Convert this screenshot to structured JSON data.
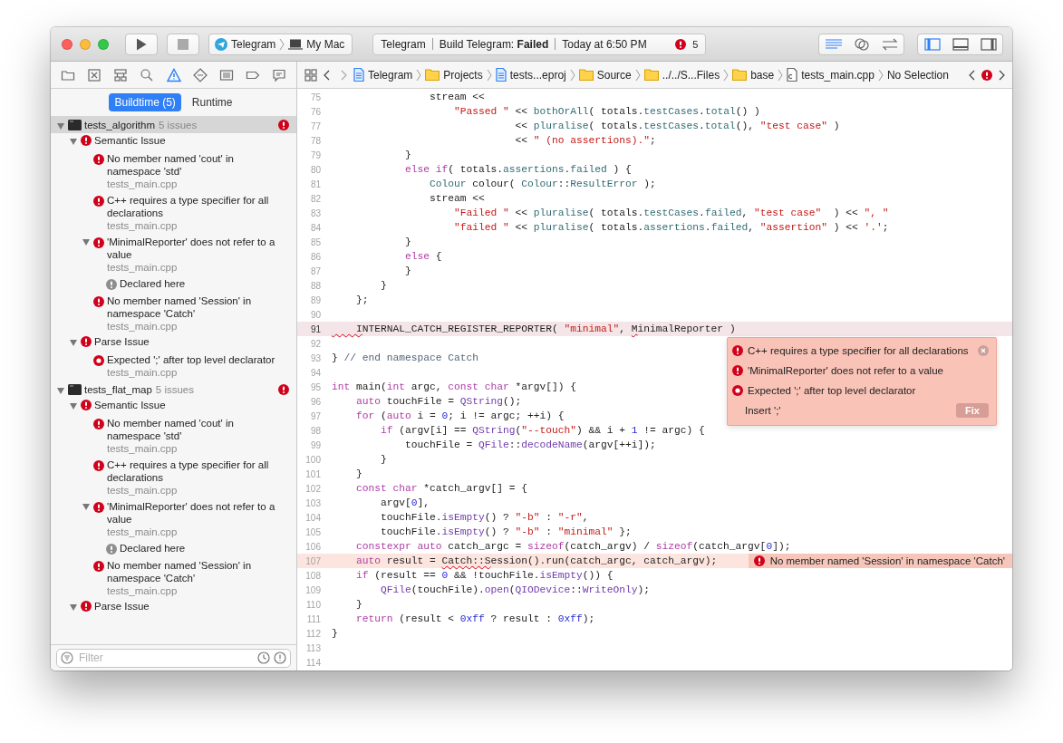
{
  "toolbar": {
    "scheme": {
      "target": "Telegram",
      "destination": "My Mac"
    },
    "activity": {
      "project": "Telegram",
      "status": "Build Telegram: **Failed**",
      "time": "Today at 6:50 PM",
      "error_count": "5"
    },
    "editor_modes": [
      {
        "selected": true
      },
      {
        "selected": false
      },
      {
        "selected": false
      }
    ],
    "panel_toggles": [
      {
        "selected": true
      },
      {
        "selected": false
      },
      {
        "selected": false
      }
    ]
  },
  "navigator_tabs": [
    {
      "selected": false
    },
    {
      "selected": false
    },
    {
      "selected": false
    },
    {
      "selected": false
    },
    {
      "selected": true
    },
    {
      "selected": false
    },
    {
      "selected": false
    },
    {
      "selected": false
    },
    {
      "selected": false
    }
  ],
  "jump_bar": {
    "crumbs": [
      {
        "kind": "project",
        "label": "Telegram"
      },
      {
        "kind": "folder",
        "label": "Projects"
      },
      {
        "kind": "project",
        "label": "tests...eproj"
      },
      {
        "kind": "folder",
        "label": "Source"
      },
      {
        "kind": "folder",
        "label": "../../S...Files"
      },
      {
        "kind": "folder",
        "label": "base"
      },
      {
        "kind": "cpp",
        "label": "tests_main.cpp"
      },
      {
        "kind": "none",
        "label": "No Selection"
      }
    ]
  },
  "sidebar": {
    "tabs": [
      {
        "label": "Buildtime (5)",
        "selected": true
      },
      {
        "label": "Runtime",
        "selected": false
      }
    ],
    "tree": [
      {
        "kind": "target",
        "name": "tests_algorithm",
        "count": "5 issues",
        "selected": true,
        "expanded": true,
        "children": [
          {
            "kind": "category",
            "label": "Semantic Issue",
            "expanded": true,
            "children": [
              {
                "kind": "error",
                "message": "No member named 'cout' in namespace 'std'",
                "file": "tests_main.cpp"
              },
              {
                "kind": "error",
                "message": "C++ requires a type specifier for all declarations",
                "file": "tests_main.cpp"
              },
              {
                "kind": "error",
                "message": "'MinimalReporter' does not refer to a value",
                "file": "tests_main.cpp",
                "expanded": true,
                "children": [
                  {
                    "kind": "note",
                    "message": "Declared here"
                  }
                ]
              },
              {
                "kind": "error",
                "message": "No member named 'Session' in namespace 'Catch'",
                "file": "tests_main.cpp"
              }
            ]
          },
          {
            "kind": "category",
            "label": "Parse Issue",
            "expanded": true,
            "children": [
              {
                "kind": "fixit",
                "message": "Expected ';' after top level declarator",
                "file": "tests_main.cpp"
              }
            ]
          }
        ]
      },
      {
        "kind": "target",
        "name": "tests_flat_map",
        "count": "5 issues",
        "selected": false,
        "expanded": true,
        "children": [
          {
            "kind": "category",
            "label": "Semantic Issue",
            "expanded": true,
            "children": [
              {
                "kind": "error",
                "message": "No member named 'cout' in namespace 'std'",
                "file": "tests_main.cpp"
              },
              {
                "kind": "error",
                "message": "C++ requires a type specifier for all declarations",
                "file": "tests_main.cpp"
              },
              {
                "kind": "error",
                "message": "'MinimalReporter' does not refer to a value",
                "file": "tests_main.cpp",
                "expanded": true,
                "children": [
                  {
                    "kind": "note",
                    "message": "Declared here"
                  }
                ]
              },
              {
                "kind": "error",
                "message": "No member named 'Session' in namespace 'Catch'",
                "file": "tests_main.cpp"
              }
            ]
          },
          {
            "kind": "category",
            "label": "Parse Issue",
            "expanded": true
          }
        ]
      }
    ],
    "filter": {
      "placeholder": "Filter"
    }
  },
  "editor": {
    "lines": [
      {
        "n": "75",
        "kind": "plain",
        "tokens": [
          {
            "kind": "p",
            "text": "                stream <<"
          }
        ]
      },
      {
        "n": "76",
        "kind": "plain",
        "tokens": [
          {
            "kind": "s",
            "text": "                    \"Passed \""
          },
          {
            "kind": "p",
            "text": " << "
          },
          {
            "kind": "t",
            "text": "bothOrAll"
          },
          {
            "kind": "p",
            "text": "( totals."
          },
          {
            "kind": "t",
            "text": "testCases"
          },
          {
            "kind": "p",
            "text": "."
          },
          {
            "kind": "t",
            "text": "total"
          },
          {
            "kind": "p",
            "text": "() )"
          }
        ]
      },
      {
        "n": "77",
        "kind": "plain",
        "tokens": [
          {
            "kind": "p",
            "text": "                              << "
          },
          {
            "kind": "t",
            "text": "pluralise"
          },
          {
            "kind": "p",
            "text": "( totals."
          },
          {
            "kind": "t",
            "text": "testCases"
          },
          {
            "kind": "p",
            "text": "."
          },
          {
            "kind": "t",
            "text": "total"
          },
          {
            "kind": "p",
            "text": "(), "
          },
          {
            "kind": "s",
            "text": "\"test case\""
          },
          {
            "kind": "p",
            "text": " )"
          }
        ]
      },
      {
        "n": "78",
        "kind": "plain",
        "tokens": [
          {
            "kind": "p",
            "text": "                              << "
          },
          {
            "kind": "s",
            "text": "\" (no assertions).\""
          },
          {
            "kind": "p",
            "text": ";"
          }
        ]
      },
      {
        "n": "79",
        "kind": "plain",
        "tokens": [
          {
            "kind": "p",
            "text": "            }"
          }
        ]
      },
      {
        "n": "80",
        "kind": "plain",
        "tokens": [
          {
            "kind": "k",
            "text": "            else if"
          },
          {
            "kind": "p",
            "text": "( totals."
          },
          {
            "kind": "t",
            "text": "assertions"
          },
          {
            "kind": "p",
            "text": "."
          },
          {
            "kind": "t",
            "text": "failed"
          },
          {
            "kind": "p",
            "text": " ) {"
          }
        ]
      },
      {
        "n": "81",
        "kind": "plain",
        "tokens": [
          {
            "kind": "t",
            "text": "                Colour"
          },
          {
            "kind": "p",
            "text": " colour( "
          },
          {
            "kind": "t",
            "text": "Colour"
          },
          {
            "kind": "p",
            "text": "::"
          },
          {
            "kind": "t",
            "text": "ResultError"
          },
          {
            "kind": "p",
            "text": " );"
          }
        ]
      },
      {
        "n": "82",
        "kind": "plain",
        "tokens": [
          {
            "kind": "p",
            "text": "                stream <<"
          }
        ]
      },
      {
        "n": "83",
        "kind": "plain",
        "tokens": [
          {
            "kind": "s",
            "text": "                    \"Failed \""
          },
          {
            "kind": "p",
            "text": " << "
          },
          {
            "kind": "t",
            "text": "pluralise"
          },
          {
            "kind": "p",
            "text": "( totals."
          },
          {
            "kind": "t",
            "text": "testCases"
          },
          {
            "kind": "p",
            "text": "."
          },
          {
            "kind": "t",
            "text": "failed"
          },
          {
            "kind": "p",
            "text": ", "
          },
          {
            "kind": "s",
            "text": "\"test case\""
          },
          {
            "kind": "p",
            "text": "  ) << "
          },
          {
            "kind": "s",
            "text": "\", \""
          }
        ]
      },
      {
        "n": "84",
        "kind": "plain",
        "tokens": [
          {
            "kind": "s",
            "text": "                    \"failed \""
          },
          {
            "kind": "p",
            "text": " << "
          },
          {
            "kind": "t",
            "text": "pluralise"
          },
          {
            "kind": "p",
            "text": "( totals."
          },
          {
            "kind": "t",
            "text": "assertions"
          },
          {
            "kind": "p",
            "text": "."
          },
          {
            "kind": "t",
            "text": "failed"
          },
          {
            "kind": "p",
            "text": ", "
          },
          {
            "kind": "s",
            "text": "\"assertion\""
          },
          {
            "kind": "p",
            "text": " ) << "
          },
          {
            "kind": "s",
            "text": "'.'"
          },
          {
            "kind": "p",
            "text": ";"
          }
        ]
      },
      {
        "n": "85",
        "kind": "plain",
        "tokens": [
          {
            "kind": "p",
            "text": "            }"
          }
        ]
      },
      {
        "n": "86",
        "kind": "plain",
        "tokens": [
          {
            "kind": "k",
            "text": "            else"
          },
          {
            "kind": "p",
            "text": " {"
          }
        ]
      },
      {
        "n": "87",
        "kind": "plain",
        "tokens": [
          {
            "kind": "p",
            "text": "            }"
          }
        ]
      },
      {
        "n": "88",
        "kind": "plain",
        "tokens": [
          {
            "kind": "p",
            "text": "        }"
          }
        ]
      },
      {
        "n": "89",
        "kind": "plain",
        "tokens": [
          {
            "kind": "p",
            "text": "    };"
          }
        ]
      },
      {
        "n": "90",
        "kind": "plain"
      },
      {
        "n": "91",
        "kind": "current",
        "tokens": [
          {
            "kind": "e",
            "text": "    I"
          },
          {
            "kind": "p",
            "text": "NTERNAL_CATCH_REGISTER_REPORTER( "
          },
          {
            "kind": "s",
            "text": "\"minimal\""
          },
          {
            "kind": "p",
            "text": ", "
          },
          {
            "kind": "e",
            "text": "M"
          },
          {
            "kind": "p",
            "text": "inimalReporter )"
          }
        ]
      },
      {
        "n": "92",
        "kind": "plain"
      },
      {
        "n": "93",
        "kind": "plain",
        "tokens": [
          {
            "kind": "p",
            "text": "} "
          },
          {
            "kind": "m",
            "text": "// end namespace Catch"
          }
        ]
      },
      {
        "n": "94",
        "kind": "plain"
      },
      {
        "n": "95",
        "kind": "plain",
        "tokens": [
          {
            "kind": "k",
            "text": "int"
          },
          {
            "kind": "p",
            "text": " main("
          },
          {
            "kind": "k",
            "text": "int"
          },
          {
            "kind": "p",
            "text": " argc, "
          },
          {
            "kind": "k",
            "text": "const char"
          },
          {
            "kind": "p",
            "text": " *argv[]) {"
          }
        ]
      },
      {
        "n": "96",
        "kind": "plain",
        "tokens": [
          {
            "kind": "k",
            "text": "    auto"
          },
          {
            "kind": "p",
            "text": " touchFile = "
          },
          {
            "kind": "c",
            "text": "QString"
          },
          {
            "kind": "p",
            "text": "();"
          }
        ]
      },
      {
        "n": "97",
        "kind": "plain",
        "tokens": [
          {
            "kind": "k",
            "text": "    for"
          },
          {
            "kind": "p",
            "text": " ("
          },
          {
            "kind": "k",
            "text": "auto"
          },
          {
            "kind": "p",
            "text": " i = "
          },
          {
            "kind": "n",
            "text": "0"
          },
          {
            "kind": "p",
            "text": "; i != argc; ++i) {"
          }
        ]
      },
      {
        "n": "98",
        "kind": "plain",
        "tokens": [
          {
            "kind": "k",
            "text": "        if"
          },
          {
            "kind": "p",
            "text": " (argv[i] == "
          },
          {
            "kind": "c",
            "text": "QString"
          },
          {
            "kind": "p",
            "text": "("
          },
          {
            "kind": "s",
            "text": "\"--touch\""
          },
          {
            "kind": "p",
            "text": ") && i + "
          },
          {
            "kind": "n",
            "text": "1"
          },
          {
            "kind": "p",
            "text": " != argc) {"
          }
        ]
      },
      {
        "n": "99",
        "kind": "plain",
        "tokens": [
          {
            "kind": "p",
            "text": "            touchFile = "
          },
          {
            "kind": "c",
            "text": "QFile"
          },
          {
            "kind": "p",
            "text": "::"
          },
          {
            "kind": "c",
            "text": "decodeName"
          },
          {
            "kind": "p",
            "text": "(argv[++i]);"
          }
        ]
      },
      {
        "n": "100",
        "kind": "plain",
        "tokens": [
          {
            "kind": "p",
            "text": "        }"
          }
        ]
      },
      {
        "n": "101",
        "kind": "plain",
        "tokens": [
          {
            "kind": "p",
            "text": "    }"
          }
        ]
      },
      {
        "n": "102",
        "kind": "plain",
        "tokens": [
          {
            "kind": "k",
            "text": "    const char"
          },
          {
            "kind": "p",
            "text": " *catch_argv[] = {"
          }
        ]
      },
      {
        "n": "103",
        "kind": "plain",
        "tokens": [
          {
            "kind": "p",
            "text": "        argv["
          },
          {
            "kind": "n",
            "text": "0"
          },
          {
            "kind": "p",
            "text": "],"
          }
        ]
      },
      {
        "n": "104",
        "kind": "plain",
        "tokens": [
          {
            "kind": "p",
            "text": "        touchFile."
          },
          {
            "kind": "c",
            "text": "isEmpty"
          },
          {
            "kind": "p",
            "text": "() ? "
          },
          {
            "kind": "s",
            "text": "\"-b\""
          },
          {
            "kind": "p",
            "text": " : "
          },
          {
            "kind": "s",
            "text": "\"-r\""
          },
          {
            "kind": "p",
            "text": ","
          }
        ]
      },
      {
        "n": "105",
        "kind": "plain",
        "tokens": [
          {
            "kind": "p",
            "text": "        touchFile."
          },
          {
            "kind": "c",
            "text": "isEmpty"
          },
          {
            "kind": "p",
            "text": "() ? "
          },
          {
            "kind": "s",
            "text": "\"-b\""
          },
          {
            "kind": "p",
            "text": " : "
          },
          {
            "kind": "s",
            "text": "\"minimal\""
          },
          {
            "kind": "p",
            "text": " };"
          }
        ]
      },
      {
        "n": "106",
        "kind": "plain",
        "tokens": [
          {
            "kind": "k",
            "text": "    constexpr auto"
          },
          {
            "kind": "p",
            "text": " catch_argc = "
          },
          {
            "kind": "k",
            "text": "sizeof"
          },
          {
            "kind": "p",
            "text": "(catch_argv) / "
          },
          {
            "kind": "k",
            "text": "sizeof"
          },
          {
            "kind": "p",
            "text": "(catch_argv["
          },
          {
            "kind": "n",
            "text": "0"
          },
          {
            "kind": "p",
            "text": "]);"
          }
        ]
      },
      {
        "n": "107",
        "kind": "error",
        "annotation": "No member named 'Session' in namespace 'Catch'",
        "tokens": [
          {
            "kind": "k",
            "text": "    auto"
          },
          {
            "kind": "p",
            "text": " result = "
          },
          {
            "kind": "e",
            "text": "Catch::S"
          },
          {
            "kind": "p",
            "text": "ession().run(catch_argc, catch_argv);"
          }
        ]
      },
      {
        "n": "108",
        "kind": "plain",
        "tokens": [
          {
            "kind": "k",
            "text": "    if"
          },
          {
            "kind": "p",
            "text": " (result == "
          },
          {
            "kind": "n",
            "text": "0"
          },
          {
            "kind": "p",
            "text": " && !touchFile."
          },
          {
            "kind": "c",
            "text": "isEmpty"
          },
          {
            "kind": "p",
            "text": "()) {"
          }
        ]
      },
      {
        "n": "109",
        "kind": "plain",
        "tokens": [
          {
            "kind": "c",
            "text": "        QFile"
          },
          {
            "kind": "p",
            "text": "(touchFile)."
          },
          {
            "kind": "c",
            "text": "open"
          },
          {
            "kind": "p",
            "text": "("
          },
          {
            "kind": "c",
            "text": "QIODevice"
          },
          {
            "kind": "p",
            "text": "::"
          },
          {
            "kind": "c",
            "text": "WriteOnly"
          },
          {
            "kind": "p",
            "text": ");"
          }
        ]
      },
      {
        "n": "110",
        "kind": "plain",
        "tokens": [
          {
            "kind": "p",
            "text": "    }"
          }
        ]
      },
      {
        "n": "111",
        "kind": "plain",
        "tokens": [
          {
            "kind": "k",
            "text": "    return"
          },
          {
            "kind": "p",
            "text": " (result < "
          },
          {
            "kind": "n",
            "text": "0xff"
          },
          {
            "kind": "p",
            "text": " ? result : "
          },
          {
            "kind": "n",
            "text": "0xff"
          },
          {
            "kind": "p",
            "text": ");"
          }
        ]
      },
      {
        "n": "112",
        "kind": "plain",
        "tokens": [
          {
            "kind": "p",
            "text": "}"
          }
        ]
      },
      {
        "n": "113",
        "kind": "plain"
      },
      {
        "n": "114",
        "kind": "plain"
      }
    ],
    "popup": {
      "issues": [
        {
          "kind": "error",
          "message": "C++ requires a type specifier for all declarations"
        },
        {
          "kind": "error",
          "message": "'MinimalReporter' does not refer to a value"
        },
        {
          "kind": "fixit",
          "message": "Expected ';' after top level declarator"
        }
      ],
      "fix": {
        "label": "Insert ';'",
        "button": "Fix"
      }
    }
  }
}
